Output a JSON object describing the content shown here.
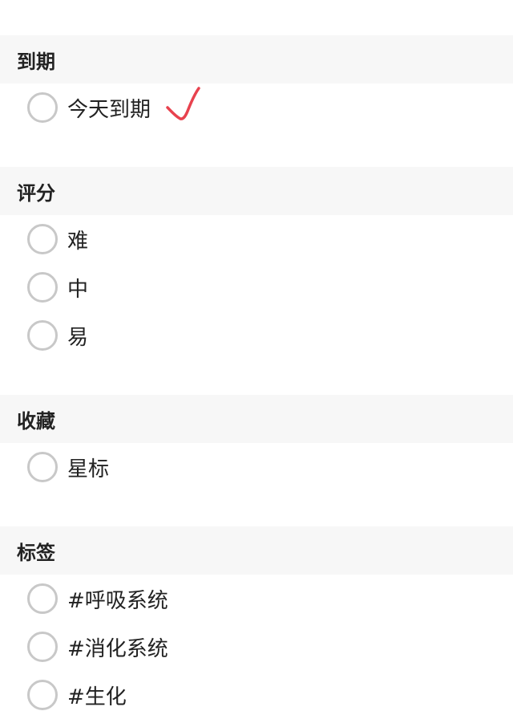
{
  "sections": [
    {
      "title": "到期",
      "options": [
        {
          "label": "今天到期",
          "checked": false,
          "annotated": true
        }
      ]
    },
    {
      "title": "评分",
      "options": [
        {
          "label": "难",
          "checked": false
        },
        {
          "label": "中",
          "checked": false
        },
        {
          "label": "易",
          "checked": false
        }
      ]
    },
    {
      "title": "收藏",
      "options": [
        {
          "label": "星标",
          "checked": false
        }
      ]
    },
    {
      "title": "标签",
      "options": [
        {
          "label": "#呼吸系统",
          "checked": false
        },
        {
          "label": "#消化系统",
          "checked": false
        },
        {
          "label": "#生化",
          "checked": false
        }
      ]
    }
  ],
  "colors": {
    "section_header_bg": "#f7f7f7",
    "radio_border": "#c8c8c8",
    "text": "#222222",
    "annotation": "#e8424e"
  },
  "icons": {
    "annotation": "handwritten-check-icon"
  }
}
